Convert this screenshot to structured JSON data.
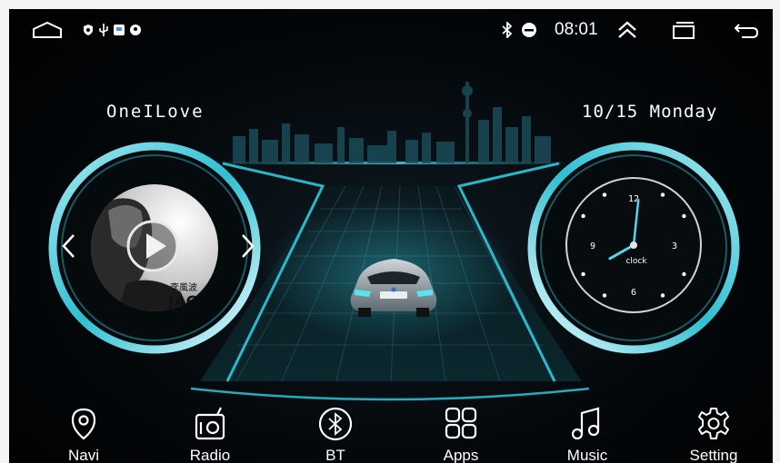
{
  "status_bar": {
    "time": "08:01",
    "icons": [
      "home-icon",
      "shield-icon",
      "usb-icon",
      "notification-icon",
      "location-icon",
      "bluetooth-icon",
      "dnd-icon",
      "expand-up-icon",
      "recent-apps-icon",
      "back-icon"
    ]
  },
  "music_widget": {
    "song_title": "OneILove",
    "album_text_line1": "李風波",
    "album_text_line2": "JAC"
  },
  "date_widget": {
    "date_text": "10/15 Monday",
    "clock": {
      "hour": 8,
      "minute": 1,
      "label": "clock",
      "numerals": [
        "12",
        "3",
        "6",
        "9"
      ]
    }
  },
  "dock": {
    "items": [
      {
        "label": "Navi",
        "icon": "map-pin-icon"
      },
      {
        "label": "Radio",
        "icon": "radio-icon"
      },
      {
        "label": "BT",
        "icon": "bluetooth-icon"
      },
      {
        "label": "Apps",
        "icon": "apps-grid-icon"
      },
      {
        "label": "Music",
        "icon": "music-note-icon"
      },
      {
        "label": "Setting",
        "icon": "gear-icon"
      }
    ]
  },
  "colors": {
    "accent": "#2fd4e6",
    "text": "#ffffff",
    "bg": "#000000"
  }
}
